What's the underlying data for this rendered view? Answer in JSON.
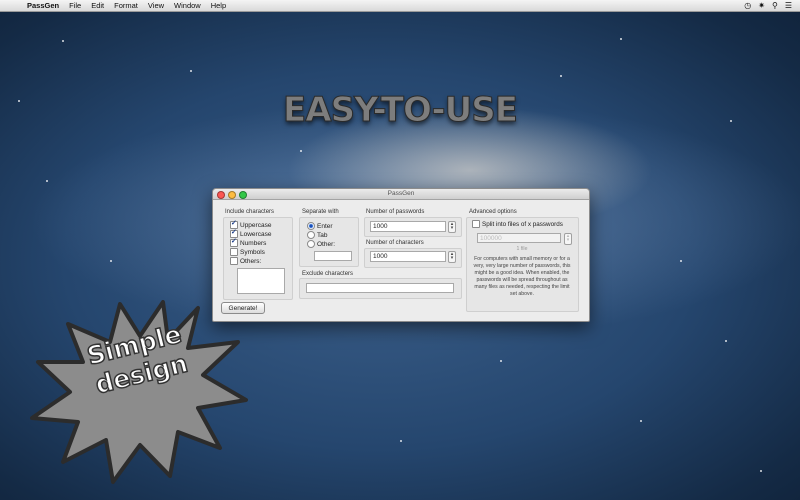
{
  "menubar": {
    "apple": "",
    "app_name": "PassGen",
    "items": [
      "File",
      "Edit",
      "Format",
      "View",
      "Window",
      "Help"
    ]
  },
  "headline": "EASY-TO-USE",
  "window": {
    "title": "PassGen",
    "include": {
      "label": "Include characters",
      "options": [
        {
          "label": "Uppercase",
          "checked": true
        },
        {
          "label": "Lowercase",
          "checked": true
        },
        {
          "label": "Numbers",
          "checked": true
        },
        {
          "label": "Symbols",
          "checked": false
        },
        {
          "label": "Others:",
          "checked": false
        }
      ],
      "others_value": ""
    },
    "separate": {
      "label": "Separate with",
      "options": [
        {
          "label": "Enter",
          "selected": true
        },
        {
          "label": "Tab",
          "selected": false
        },
        {
          "label": "Other:",
          "selected": false
        }
      ],
      "other_value": ""
    },
    "num_passwords": {
      "label": "Number of passwords",
      "value": "1000"
    },
    "num_characters": {
      "label": "Number of characters",
      "value": "1000"
    },
    "exclude": {
      "label": "Exclude characters",
      "value": ""
    },
    "generate_label": "Generate!",
    "advanced": {
      "label": "Advanced options",
      "split_label": "Split into files of x passwords",
      "split_checked": false,
      "split_placeholder": "100000",
      "files_text": "1 file",
      "note": "For computers with small memory or for a very, very large number of passwords, this might be a good idea. When enabled, the passwords will be spread throughout as many files as needed, respecting the limit set above."
    }
  },
  "badge": {
    "line1": "Simple",
    "line2": "design"
  },
  "colors": {
    "badge_fill": "#8c8c8c",
    "badge_stroke": "#2c2c2c",
    "accent": "#1b4fb8"
  }
}
